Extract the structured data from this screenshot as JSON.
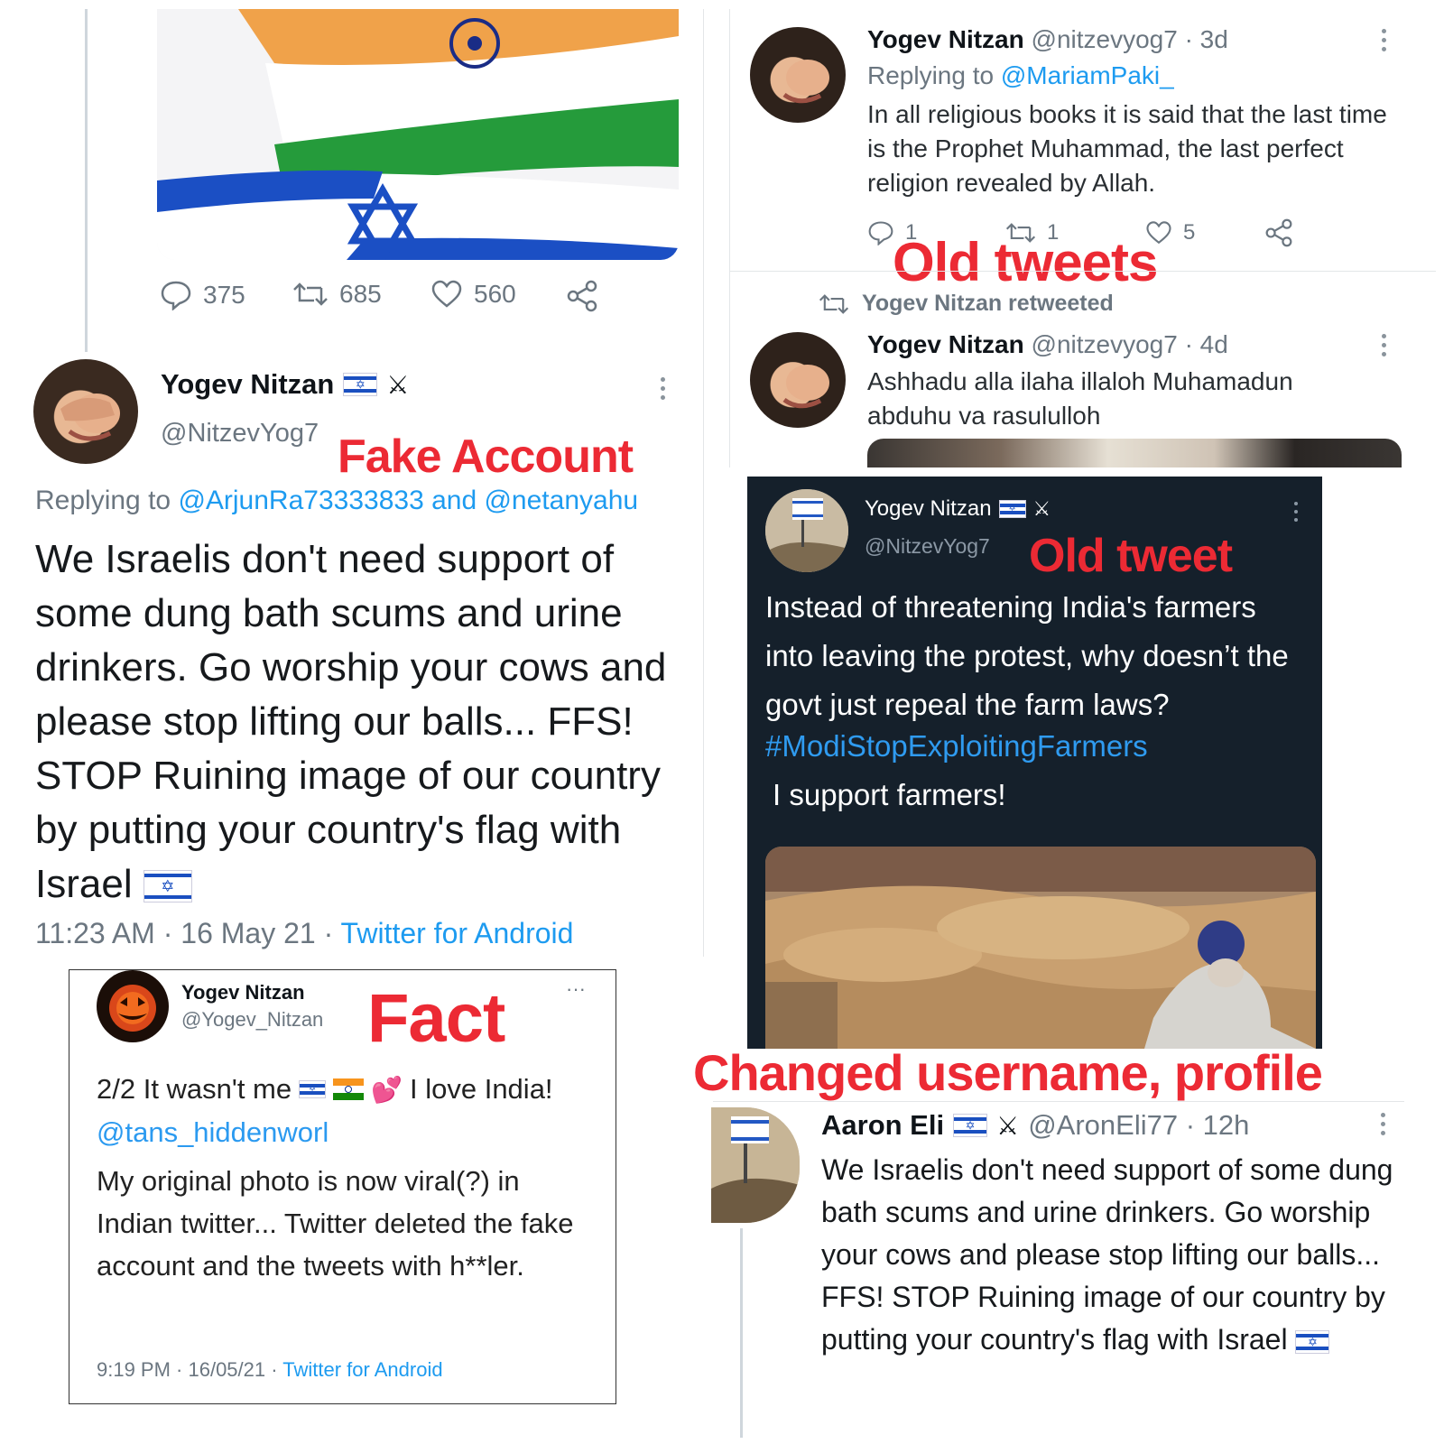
{
  "colors": {
    "accent_red": "#ec2a34",
    "link_blue": "#1d9bf0",
    "dark_bg": "#15202b"
  },
  "panel_top_left": {
    "stats": {
      "replies": "375",
      "retweets": "685",
      "likes": "560"
    },
    "name": "Yogev Nitzan",
    "handle": "@NitzevYog7",
    "label": "Fake Account",
    "replying_prefix": "Replying to ",
    "replying_to": "@ArjunRa73333833 and @netanyahu",
    "text": "We Israelis don't need support of some dung bath scums and urine drinkers. Go worship your cows and please stop lifting our balls... FFS! STOP Ruining image of our country by putting your country's flag with Israel",
    "time": "11:23 AM · 16 May 21 · ",
    "source": "Twitter for Android"
  },
  "panel_top_right": {
    "tweet1": {
      "name": "Yogev Nitzan",
      "handle_time": "@nitzevyog7 · 3d",
      "replying_prefix": "Replying to ",
      "replying_to": "@MariamPaki_",
      "text": "In all religious books it is said that the last time is the Prophet Muhammad, the last perfect religion revealed by Allah.",
      "replies": "1",
      "retweets": "1",
      "likes": "5"
    },
    "label": "Old tweets",
    "retweeted_note": "Yogev Nitzan retweeted",
    "tweet2": {
      "name": "Yogev Nitzan",
      "handle_time": "@nitzevyog7 · 4d",
      "text": "Ashhadu alla ilaha illaloh Muhamadun abduhu va rasululloh"
    }
  },
  "panel_dark": {
    "name": "Yogev Nitzan",
    "handle": "@NitzevYog7",
    "label": "Old tweet",
    "text": "Instead of threatening India's farmers into leaving the protest, why doesn’t the govt just repeal the farm laws?",
    "hashtag": "#ModiStopExploitingFarmers",
    "text2": "I support farmers!"
  },
  "panel_fact": {
    "name": "Yogev Nitzan",
    "handle": "@Yogev_Nitzan",
    "label": "Fact",
    "line1_a": "2/2 It wasn't me",
    "line1_b": " I love India!",
    "mention": "@tans_hiddenworl",
    "text": "My original photo is now viral(?) in Indian twitter... Twitter deleted the fake account and the tweets with h**ler.",
    "time": "9:19 PM · 16/05/21 · ",
    "source": "Twitter for Android",
    "more": "···"
  },
  "panel_bottom_right": {
    "label": "Changed username, profile",
    "name": "Aaron Eli",
    "handle_time": "@AronEli77 · 12h",
    "text": "We Israelis don't need support of some dung bath scums and urine drinkers. Go worship your cows and please stop lifting our balls... FFS! STOP Ruining image of our country by putting your country's flag with Israel"
  }
}
